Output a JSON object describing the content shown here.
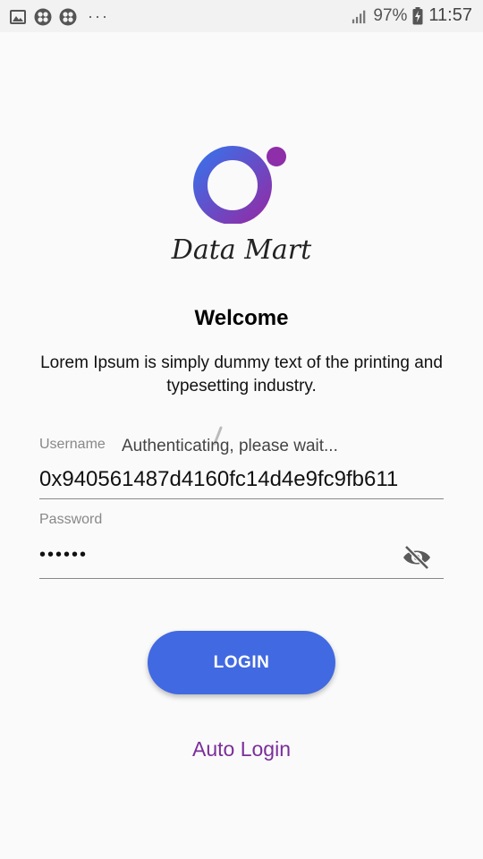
{
  "status_bar": {
    "signal_percent": "97%",
    "time": "11:57",
    "more_dots": "···"
  },
  "brand": {
    "name": "Data Mart",
    "colors": {
      "ring_start": "#3b6fe8",
      "ring_end": "#8e2ea8",
      "dot": "#8e2ea8"
    }
  },
  "welcome": {
    "title": "Welcome",
    "description": "Lorem Ipsum is simply dummy text of the printing and typesetting industry."
  },
  "form": {
    "username_label": "Username",
    "username_value": "0x940561487d4160fc14d4e9fc9fb611",
    "password_label": "Password",
    "password_value": "••••••",
    "progress_message": "Authenticating, please wait..."
  },
  "actions": {
    "login_label": "LOGIN",
    "auto_login_label": "Auto Login"
  },
  "colors": {
    "primary": "#4169e1",
    "accent": "#7b2e9a"
  }
}
